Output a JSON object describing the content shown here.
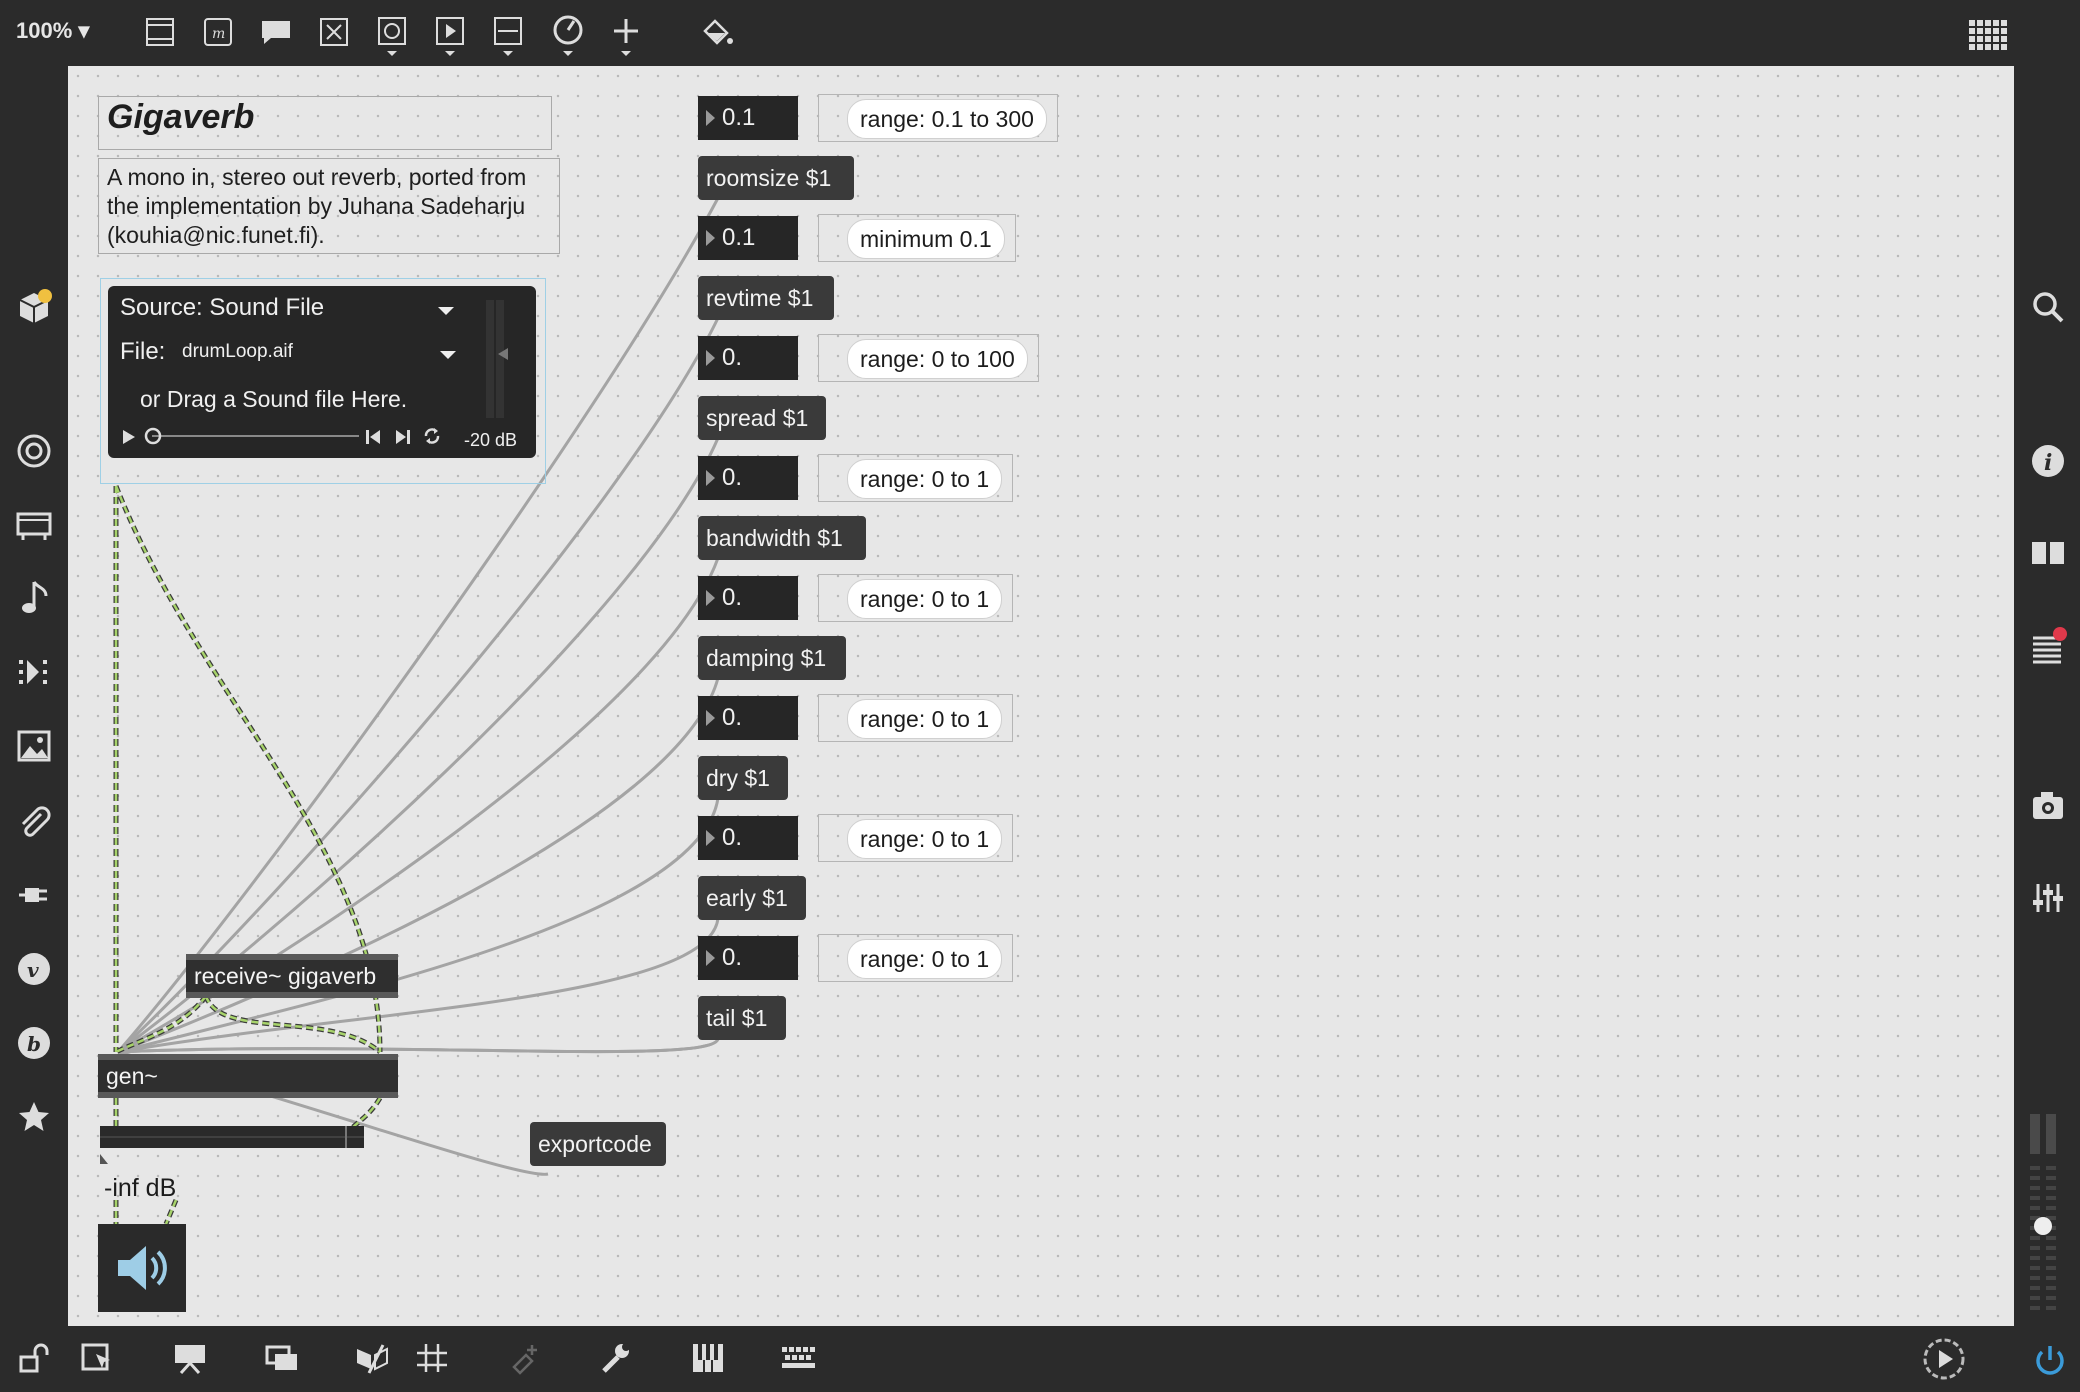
{
  "toolbar": {
    "zoom": "100%",
    "icons": [
      "object-box",
      "message",
      "comment",
      "toggle",
      "button",
      "playbar",
      "slider",
      "dial",
      "add",
      "paint-bucket"
    ]
  },
  "patch": {
    "title": "Gigaverb",
    "description": "A mono in, stereo out reverb, ported from the implementation by Juhana Sadeharju (kouhia@nic.funet.fi).",
    "player": {
      "source": "Source: Sound File",
      "file_label": "File:",
      "file_name": "drumLoop.aif",
      "drag_hint": "or Drag a Sound file Here.",
      "gain": "-20 dB"
    },
    "params": [
      {
        "num": "0.1",
        "attr": "range: 0.1 to 300",
        "msg": "roomsize $1"
      },
      {
        "num": "0.1",
        "attr": "minimum 0.1",
        "msg": "revtime $1"
      },
      {
        "num": "0.",
        "attr": "range: 0 to 100",
        "msg": "spread $1"
      },
      {
        "num": "0.",
        "attr": "range: 0 to 1",
        "msg": "bandwidth $1"
      },
      {
        "num": "0.",
        "attr": "range: 0 to 1",
        "msg": "damping $1"
      },
      {
        "num": "0.",
        "attr": "range: 0 to 1",
        "msg": "dry $1"
      },
      {
        "num": "0.",
        "attr": "range: 0 to 1",
        "msg": "early $1"
      },
      {
        "num": "0.",
        "attr": "range: 0 to 1",
        "msg": "tail $1"
      }
    ],
    "receive": "receive~ gigaverb",
    "gen": "gen~",
    "export": "exportcode",
    "meter_level": "-inf dB"
  },
  "colors": {
    "canvas": "#e7e7e7",
    "chrome": "#2b2b2b",
    "signal_wire": "#a7d36b",
    "notification": "#f0c040",
    "alert": "#e0394b"
  }
}
